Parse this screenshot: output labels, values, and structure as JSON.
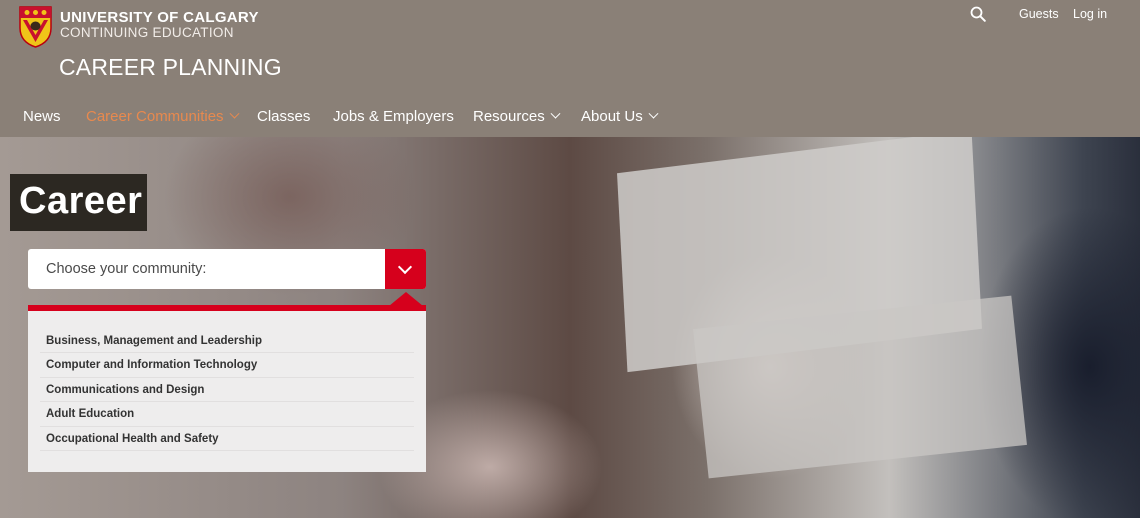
{
  "header": {
    "brand": {
      "line1": "UNIVERSITY OF CALGARY",
      "line2": "CONTINUING EDUCATION",
      "logo_icon": "university-crest-icon"
    },
    "site_title": "CAREER PLANNING",
    "utility": {
      "search_icon": "search-icon",
      "links": [
        {
          "label": "Guests"
        },
        {
          "label": "Log in"
        }
      ]
    },
    "nav": [
      {
        "label": "News",
        "has_dropdown": false,
        "active": false
      },
      {
        "label": "Career Communities",
        "has_dropdown": true,
        "active": true
      },
      {
        "label": "Classes",
        "has_dropdown": false,
        "active": false
      },
      {
        "label": "Jobs & Employers",
        "has_dropdown": false,
        "active": false
      },
      {
        "label": "Resources",
        "has_dropdown": true,
        "active": false
      },
      {
        "label": "About Us",
        "has_dropdown": true,
        "active": false
      }
    ]
  },
  "hero": {
    "title": "Career",
    "community_select": {
      "label": "Choose your community:",
      "expanded": true,
      "options": [
        "Business, Management and Leadership",
        "Computer and Information Technology",
        "Communications and Design",
        "Adult Education",
        "Occupational Health and Safety"
      ]
    }
  },
  "colors": {
    "header_bg": "#8a8077",
    "nav_active": "#e8894e",
    "accent_red": "#d6001c",
    "title_box_bg": "#2c2822",
    "dropdown_bg": "#eeeded"
  }
}
